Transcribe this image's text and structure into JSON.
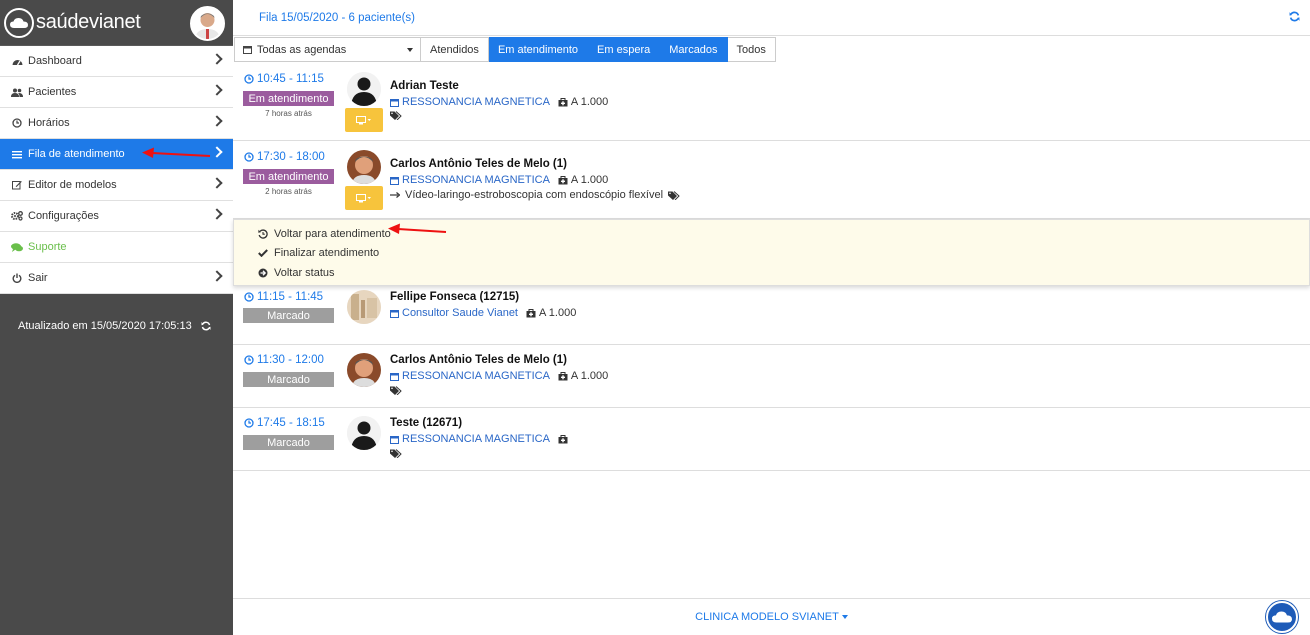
{
  "brand": {
    "name": "saúdevianet"
  },
  "sidebar": {
    "items": [
      {
        "label": "Dashboard",
        "icon": "dashboard-icon"
      },
      {
        "label": "Pacientes",
        "icon": "users-icon"
      },
      {
        "label": "Horários",
        "icon": "clock-icon"
      },
      {
        "label": "Fila de atendimento",
        "icon": "list-icon"
      },
      {
        "label": "Editor de modelos",
        "icon": "edit-icon"
      },
      {
        "label": "Configurações",
        "icon": "cogs-icon"
      },
      {
        "label": "Suporte",
        "icon": "chat-icon"
      },
      {
        "label": "Sair",
        "icon": "power-icon"
      }
    ],
    "updated": "Atualizado em 15/05/2020 17:05:13"
  },
  "header": {
    "title": "Fila 15/05/2020 - 6 paciente(s)"
  },
  "filters": {
    "agenda": "Todas as agendas",
    "tabs": [
      "Atendidos",
      "Em atendimento",
      "Em espera",
      "Marcados",
      "Todos"
    ]
  },
  "rows": [
    {
      "time": "10:45 - 11:15",
      "status": "Em atendimento",
      "ago": "7 horas atrás",
      "name": "Adrian Teste",
      "agenda": "RESSONANCIA MAGNETICA",
      "plan": "A 1.000",
      "note": ""
    },
    {
      "time": "17:30 - 18:00",
      "status": "Em atendimento",
      "ago": "2 horas atrás",
      "name": "Carlos Antônio Teles de Melo (1)",
      "agenda": "RESSONANCIA MAGNETICA",
      "plan": "A 1.000",
      "note": "Vídeo-laringo-estroboscopia com endoscópio flexível"
    },
    {
      "time": "11:15 - 11:45",
      "status": "Marcado",
      "name": "Fellipe Fonseca (12715)",
      "agenda": "Consultor Saude Vianet",
      "plan": "A 1.000"
    },
    {
      "time": "11:30 - 12:00",
      "status": "Marcado",
      "name": "Carlos Antônio Teles de Melo (1)",
      "agenda": "RESSONANCIA MAGNETICA",
      "plan": "A 1.000"
    },
    {
      "time": "17:45 - 18:15",
      "status": "Marcado",
      "name": "Teste (12671)",
      "agenda": "RESSONANCIA MAGNETICA",
      "plan": ""
    }
  ],
  "dropdown": {
    "items": [
      "Voltar para atendimento",
      "Finalizar atendimento",
      "Voltar status"
    ]
  },
  "footer": {
    "clinic": "CLINICA MODELO SVIANET"
  },
  "colors": {
    "primary": "#1e7ae8",
    "sidebar": "#4a4a4a",
    "purple": "#9b5c9e",
    "gray": "#9e9e9e",
    "yellow": "#f7c43c"
  }
}
